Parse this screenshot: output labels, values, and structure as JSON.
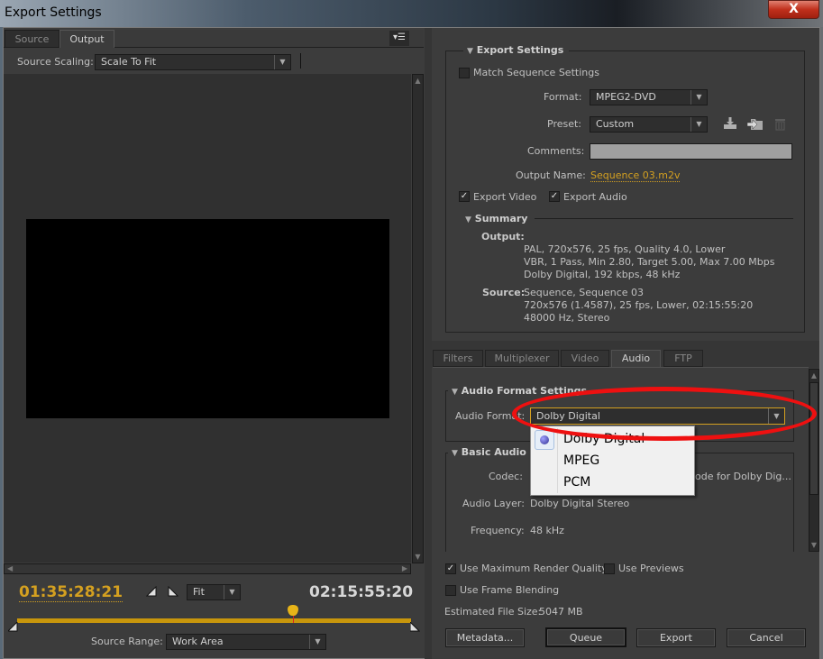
{
  "window": {
    "title": "Export Settings",
    "close_label": "X"
  },
  "left_panel": {
    "tabs": [
      {
        "label": "Source",
        "active": false
      },
      {
        "label": "Output",
        "active": true
      }
    ],
    "panel_menu_icon": "panel-menu-icon",
    "source_scaling_label": "Source Scaling:",
    "source_scaling_value": "Scale To Fit",
    "current_timecode": "01:35:28:21",
    "duration_timecode": "02:15:55:20",
    "zoom_value": "Fit",
    "source_range_label": "Source Range:",
    "source_range_value": "Work Area",
    "playhead_position_fraction": 0.7
  },
  "export_settings": {
    "section_title": "Export Settings",
    "match_sequence_label": "Match Sequence Settings",
    "match_sequence_checked": false,
    "format_label": "Format:",
    "format_value": "MPEG2-DVD",
    "preset_label": "Preset:",
    "preset_value": "Custom",
    "comments_label": "Comments:",
    "comments_value": "",
    "output_name_label": "Output Name:",
    "output_name_value": "Sequence 03.m2v",
    "export_video_label": "Export Video",
    "export_video_checked": true,
    "export_audio_label": "Export Audio",
    "export_audio_checked": true,
    "summary": {
      "title": "Summary",
      "output_label": "Output:",
      "output_lines": [
        "PAL, 720x576, 25 fps, Quality 4.0, Lower",
        "VBR, 1 Pass, Min 2.80, Target 5.00, Max 7.00 Mbps",
        "Dolby Digital, 192 kbps, 48 kHz"
      ],
      "source_label": "Source:",
      "source_lines": [
        "Sequence, Sequence 03",
        "720x576 (1.4587), 25 fps, Lower, 02:15:55:20",
        "48000 Hz, Stereo"
      ]
    }
  },
  "settings_tabs": [
    {
      "label": "Filters",
      "active": false
    },
    {
      "label": "Multiplexer",
      "active": false
    },
    {
      "label": "Video",
      "active": false
    },
    {
      "label": "Audio",
      "active": true
    },
    {
      "label": "FTP",
      "active": false
    }
  ],
  "audio": {
    "format_section_title": "Audio Format Settings",
    "audio_format_label": "Audio Format:",
    "audio_format_value": "Dolby Digital",
    "audio_format_options": [
      "Dolby Digital",
      "MPEG",
      "PCM"
    ],
    "basic_section_title": "Basic Audio Settings",
    "codec_label": "Codec:",
    "codec_value": "ode for Dolby Dig...",
    "audio_layer_label": "Audio Layer:",
    "audio_layer_value": "Dolby Digital Stereo",
    "frequency_label": "Frequency:",
    "frequency_value": "48 kHz"
  },
  "bottom": {
    "max_render_label": "Use Maximum Render Quality",
    "max_render_checked": true,
    "use_previews_label": "Use Previews",
    "use_previews_checked": false,
    "frame_blending_label": "Use Frame Blending",
    "frame_blending_checked": false,
    "est_size_label": "Estimated File Size:",
    "est_size_value": "5047 MB",
    "buttons": {
      "metadata": "Metadata...",
      "queue": "Queue",
      "export": "Export",
      "cancel": "Cancel"
    }
  },
  "colors": {
    "accent": "#d4a020",
    "annotation": "#ee1010",
    "panel_bg": "#3c3c3c"
  }
}
